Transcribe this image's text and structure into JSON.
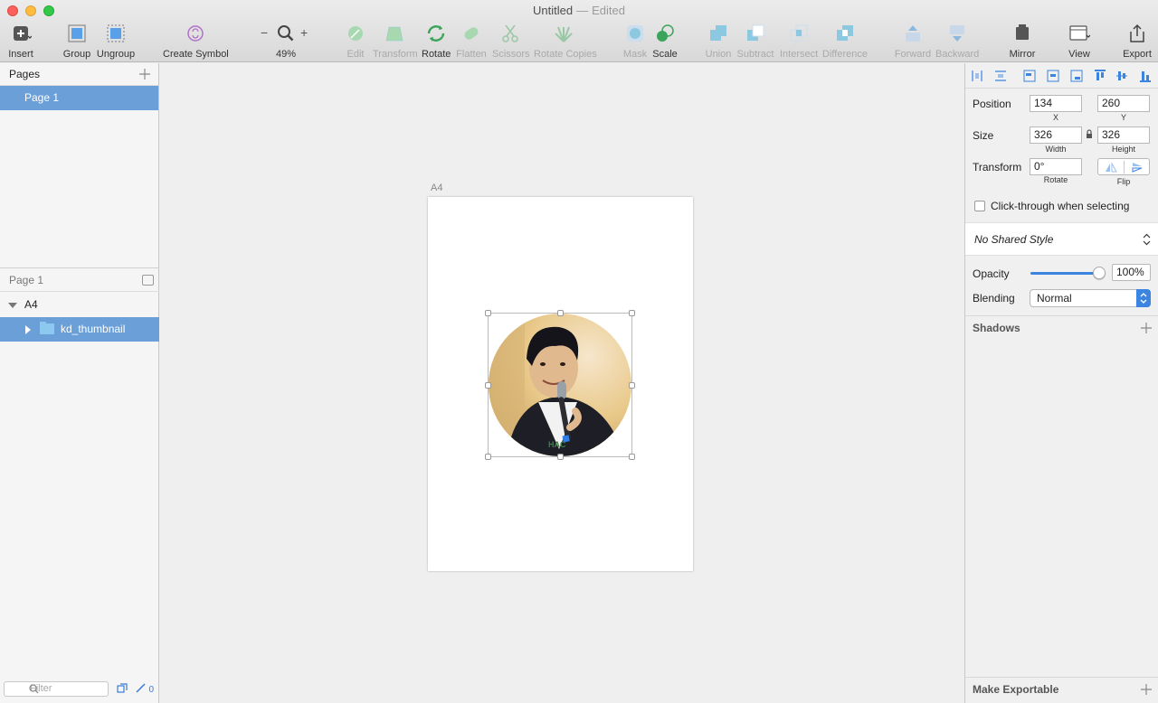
{
  "window": {
    "title": "Untitled",
    "separator": "—",
    "status": "Edited"
  },
  "toolbar": {
    "insert": "Insert",
    "group": "Group",
    "ungroup": "Ungroup",
    "create_symbol": "Create Symbol",
    "zoom_minus": "−",
    "zoom_plus": "+",
    "zoom": "49%",
    "edit": "Edit",
    "transform": "Transform",
    "rotate": "Rotate",
    "flatten": "Flatten",
    "scissors": "Scissors",
    "rotate_copies": "Rotate Copies",
    "mask": "Mask",
    "scale": "Scale",
    "union": "Union",
    "subtract": "Subtract",
    "intersect": "Intersect",
    "difference": "Difference",
    "forward": "Forward",
    "backward": "Backward",
    "mirror": "Mirror",
    "view": "View",
    "export": "Export"
  },
  "sidebar": {
    "pages_header": "Pages",
    "pages": [
      {
        "label": "Page 1",
        "selected": true
      }
    ],
    "layers_header": "Page 1",
    "artboard": "A4",
    "group": "kd_thumbnail",
    "filter_placeholder": "Filter",
    "footer_count": "0"
  },
  "canvas": {
    "artboard_label": "A4"
  },
  "inspector": {
    "position_label": "Position",
    "x": "134",
    "x_label": "X",
    "y": "260",
    "y_label": "Y",
    "size_label": "Size",
    "width": "326",
    "width_label": "Width",
    "height": "326",
    "height_label": "Height",
    "transform_label": "Transform",
    "rotate": "0°",
    "rotate_label": "Rotate",
    "flip_label": "Flip",
    "click_through": "Click-through when selecting",
    "shared_style": "No Shared Style",
    "opacity_label": "Opacity",
    "opacity": "100%",
    "opacity_level": 1.0,
    "blending_label": "Blending",
    "blending": "Normal",
    "shadows": "Shadows",
    "make_exportable": "Make Exportable"
  },
  "colors": {
    "selection_blue": "#6a9fd8",
    "accent_blue": "#3b84e0"
  }
}
